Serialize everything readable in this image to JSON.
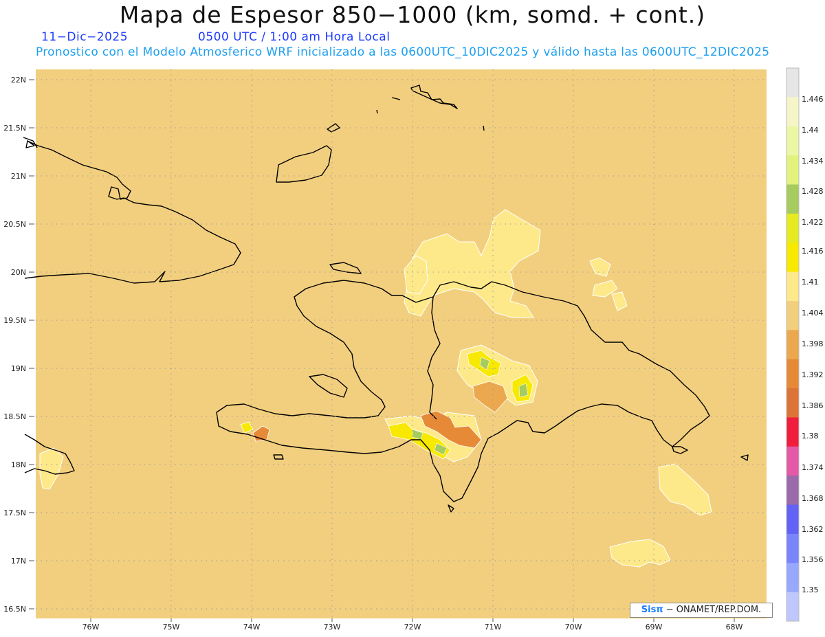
{
  "header": {
    "title": "Mapa de Espesor 850−1000 (km, somd. + cont.)",
    "date": "11−Dic−2025",
    "time": "0500 UTC / 1:00 am Hora Local",
    "forecast": "Pronostico con el Modelo Atmosferico WRF inicializado a las 0600UTC_10DIC2025 y válido hasta las  0600UTC_12DIC2025"
  },
  "map": {
    "lat_labels": [
      "22N",
      "21.5N",
      "21N",
      "20.5N",
      "20N",
      "19.5N",
      "19N",
      "18.5N",
      "18N",
      "17.5N",
      "17N",
      "16.5N"
    ],
    "lon_labels": [
      "76W",
      "75W",
      "74W",
      "73W",
      "72W",
      "71W",
      "70W",
      "69W",
      "68W"
    ],
    "lat_values": [
      22,
      21.5,
      21,
      20.5,
      20,
      19.5,
      19,
      18.5,
      18,
      17.5,
      17,
      16.5
    ],
    "lon_values": [
      -76,
      -75,
      -74,
      -73,
      -72,
      -71,
      -70,
      -69,
      -68
    ],
    "background_color": "#f2cf7e",
    "coast_color": "#000000"
  },
  "colorbar": {
    "labels": [
      "1.446",
      "1.44",
      "1.434",
      "1.428",
      "1.422",
      "1.416",
      "1.41",
      "1.404",
      "1.398",
      "1.392",
      "1.386",
      "1.38",
      "1.374",
      "1.368",
      "1.362",
      "1.356",
      "1.35"
    ],
    "colors": [
      "#e6e6e6",
      "#f5f5c8",
      "#ecf7a6",
      "#e2f27c",
      "#a6cb5e",
      "#e6ea20",
      "#f7e900",
      "#fde98a",
      "#f2cf7e",
      "#eba84e",
      "#e68a38",
      "#dc7438",
      "#f01e3c",
      "#e45aa6",
      "#9a6aaa",
      "#6262f6",
      "#7a84fd",
      "#97a9fe",
      "#bfc8fe"
    ]
  },
  "credit": {
    "brand": "Sisπ",
    "org": "− ONAMET/REP.DOM."
  }
}
